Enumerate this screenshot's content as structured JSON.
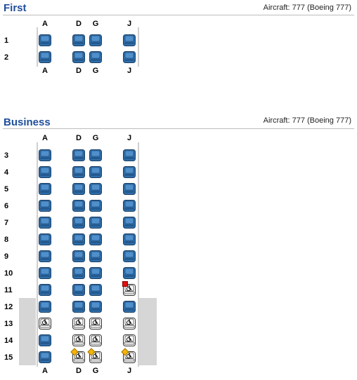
{
  "columns": [
    "A",
    "D",
    "G",
    "J"
  ],
  "first": {
    "title": "First",
    "aircraft": "Aircraft: 777 (Boeing 777)",
    "rows": [
      {
        "label": "1",
        "seats": [
          "available",
          "available",
          "available",
          "available"
        ]
      },
      {
        "label": "2",
        "seats": [
          "available",
          "available",
          "available",
          "available"
        ]
      }
    ]
  },
  "business": {
    "title": "Business",
    "aircraft": "Aircraft: 777 (Boeing 777)",
    "rows": [
      {
        "label": "3",
        "seats": [
          "available",
          "available",
          "available",
          "available"
        ]
      },
      {
        "label": "4",
        "seats": [
          "available",
          "available",
          "available",
          "available"
        ]
      },
      {
        "label": "5",
        "seats": [
          "available",
          "available",
          "available",
          "available"
        ]
      },
      {
        "label": "6",
        "seats": [
          "available",
          "available",
          "available",
          "available"
        ]
      },
      {
        "label": "7",
        "seats": [
          "available",
          "available",
          "available",
          "available"
        ]
      },
      {
        "label": "8",
        "seats": [
          "available",
          "available",
          "available",
          "available"
        ]
      },
      {
        "label": "9",
        "seats": [
          "available",
          "available",
          "available",
          "available"
        ]
      },
      {
        "label": "10",
        "seats": [
          "available",
          "available",
          "available",
          "available"
        ]
      },
      {
        "label": "11",
        "seats": [
          "available",
          "available",
          "available",
          "accessible-flagged"
        ]
      },
      {
        "label": "12",
        "seats": [
          "available",
          "available",
          "available",
          "available"
        ]
      },
      {
        "label": "13",
        "seats": [
          "accessible",
          "accessible",
          "accessible",
          "accessible"
        ]
      },
      {
        "label": "14",
        "seats": [
          "available",
          "accessible",
          "accessible",
          "accessible"
        ]
      },
      {
        "label": "15",
        "seats": [
          "available",
          "accessible-diamond",
          "accessible-diamond",
          "accessible-diamond"
        ]
      }
    ]
  },
  "legend_colors": {
    "available_seat": "#2f6fab",
    "accessible_seat": "#ffffff",
    "flag": "#dd1111",
    "diamond": "#f2b705"
  }
}
